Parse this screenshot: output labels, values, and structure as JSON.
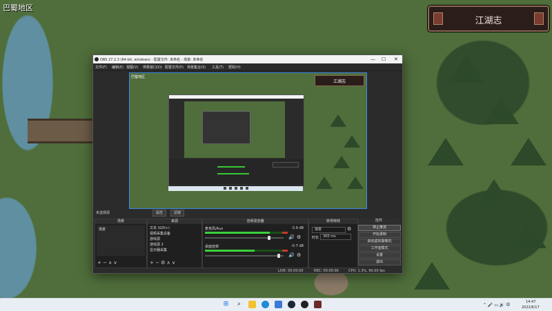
{
  "game": {
    "area_label": "巴蜀地区",
    "location": "江湖志"
  },
  "obs": {
    "title": "OBS 27.2.3 (64-bit, windows) - 配置文件: 未命名 - 场景: 未命名",
    "window_controls": {
      "minimize": "—",
      "maximize": "☐",
      "close": "✕"
    },
    "menu": [
      "文件(F)",
      "编辑(E)",
      "视图(V)",
      "停靠窗口(D)",
      "配置文件(P)",
      "场景集合(S)",
      "工具(T)",
      "帮助(H)"
    ],
    "preview": {
      "area_label": "巴蜀地区",
      "location": "江湖志"
    },
    "source_bar": {
      "label": "未选择源",
      "properties": "属性",
      "filters": "滤镜"
    },
    "scenes": {
      "header": "场景",
      "items": [
        "场景"
      ],
      "footer": "+ − ∧ ∨"
    },
    "sources": {
      "header": "来源",
      "items": [
        "文本 (GDI+)",
        "视频采集设备",
        "游戏源",
        "游戏源 2",
        "显示器采集"
      ],
      "footer": "+ − ⚙ ∧ ∨"
    },
    "mixer": {
      "header": "音频混音器",
      "channels": [
        {
          "name": "麦克风/Aux",
          "db": "-3.9 dB",
          "level": 0.78,
          "fader": 0.82
        },
        {
          "name": "桌面音频",
          "db": "-0.7 dB",
          "level": 0.6,
          "fader": 0.94
        }
      ]
    },
    "transitions": {
      "header": "转场特效",
      "type": "渐变",
      "duration_label": "时长",
      "duration": "300 ms"
    },
    "controls": {
      "header": "控件",
      "buttons": [
        "停止推流",
        "开始录制",
        "启动虚拟摄像机",
        "工作室模式",
        "设置",
        "退出"
      ]
    },
    "status": {
      "live": "LIVE: 00:00:00",
      "rec": "REC: 00:00:00",
      "cpu": "CPU: 1.3%, 60.00 fps"
    }
  },
  "taskbar": {
    "time": "14:47",
    "date": "2022/6/17",
    "icons": [
      "windows-start",
      "search",
      "file-explorer",
      "edge",
      "store",
      "steam",
      "obs",
      "game"
    ]
  },
  "colors": {
    "accent_blue": "#3b87e0",
    "meter_green": "#3bd13b",
    "meter_red": "#c83a2a"
  }
}
